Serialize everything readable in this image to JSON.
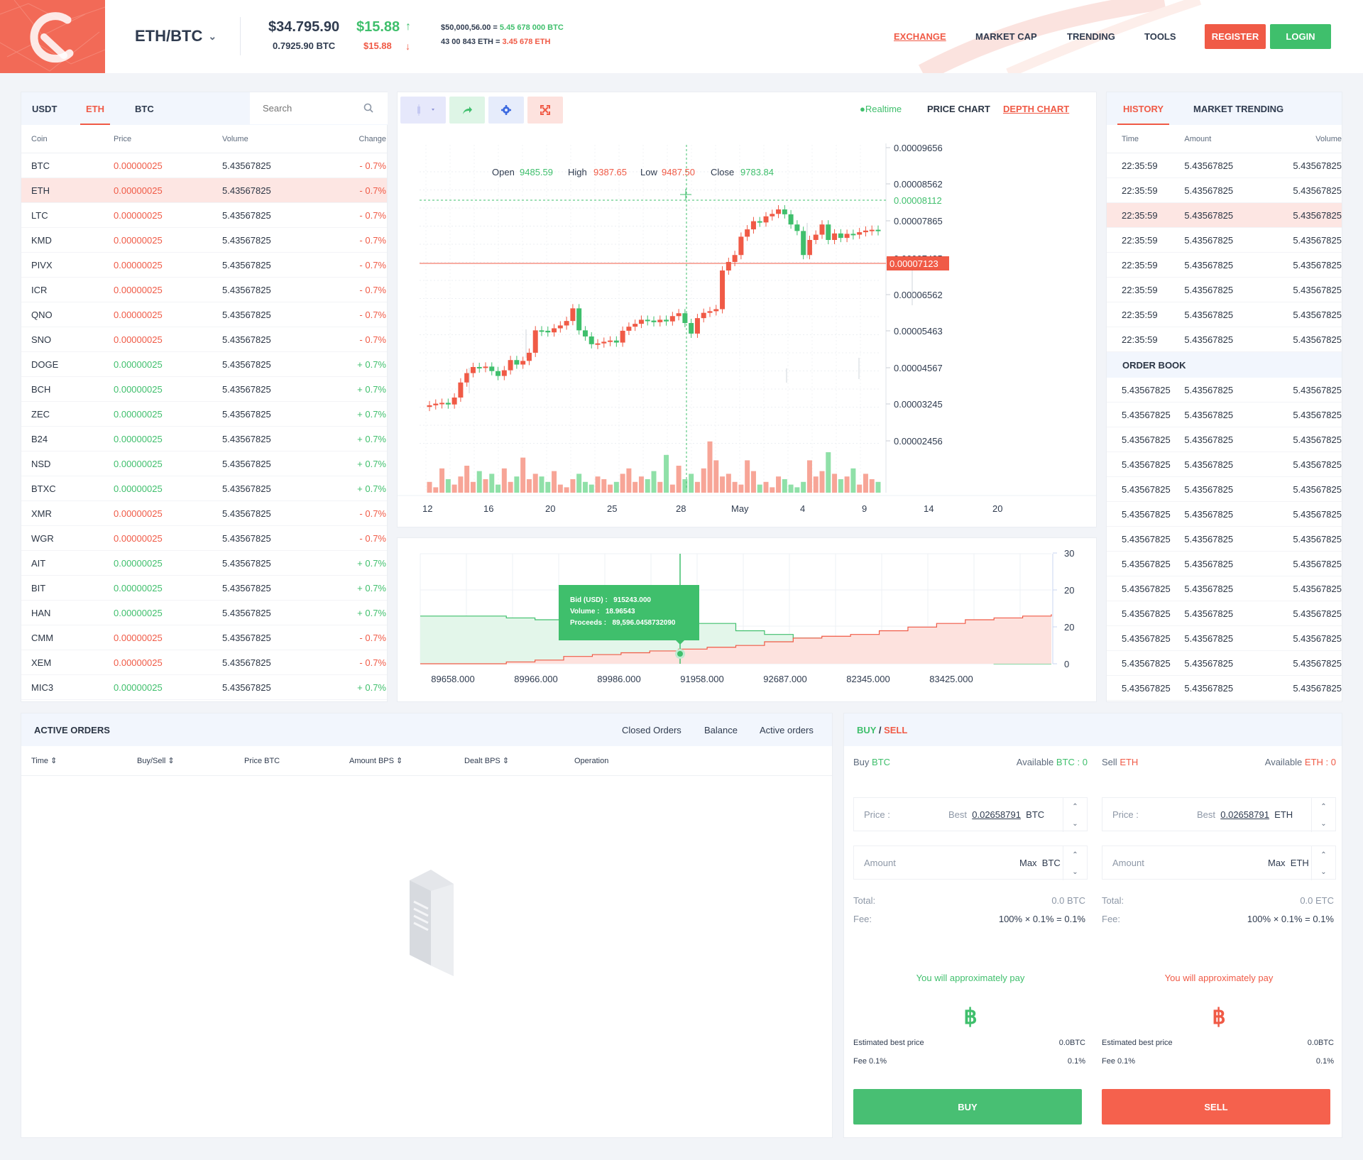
{
  "header": {
    "pair": "ETH/BTC",
    "price_usd": "$34.795.90",
    "price_btc": "0.7925.90 BTC",
    "change_up": "$15.88",
    "change_down": "$15.88",
    "conv1_a": "$50,000,56.00 = ",
    "conv1_b": "5.45 678 000 BTC",
    "conv2_a": "43 00 843 ETH = ",
    "conv2_b": "3.45 678 ETH",
    "nav": [
      "EXCHANGE",
      "MARKET CAP",
      "TRENDING",
      "TOOLS"
    ],
    "register": "REGISTER",
    "login": "LOGIN"
  },
  "market": {
    "tabs": [
      "USDT",
      "ETH",
      "BTC"
    ],
    "active_tab": "ETH",
    "search_placeholder": "Search",
    "columns": [
      "Coin",
      "Price",
      "Volume",
      "Change"
    ],
    "rows": [
      {
        "coin": "BTC",
        "price": "0.00000025",
        "volume": "5.43567825",
        "change": "- 0.7%",
        "dir": "down"
      },
      {
        "coin": "ETH",
        "price": "0.00000025",
        "volume": "5.43567825",
        "change": "- 0.7%",
        "dir": "down"
      },
      {
        "coin": "LTC",
        "price": "0.00000025",
        "volume": "5.43567825",
        "change": "- 0.7%",
        "dir": "down"
      },
      {
        "coin": "KMD",
        "price": "0.00000025",
        "volume": "5.43567825",
        "change": "- 0.7%",
        "dir": "down"
      },
      {
        "coin": "PIVX",
        "price": "0.00000025",
        "volume": "5.43567825",
        "change": "- 0.7%",
        "dir": "down"
      },
      {
        "coin": "ICR",
        "price": "0.00000025",
        "volume": "5.43567825",
        "change": "- 0.7%",
        "dir": "down"
      },
      {
        "coin": "QNO",
        "price": "0.00000025",
        "volume": "5.43567825",
        "change": "- 0.7%",
        "dir": "down"
      },
      {
        "coin": "SNO",
        "price": "0.00000025",
        "volume": "5.43567825",
        "change": "- 0.7%",
        "dir": "down"
      },
      {
        "coin": "DOGE",
        "price": "0.00000025",
        "volume": "5.43567825",
        "change": "+ 0.7%",
        "dir": "up"
      },
      {
        "coin": "BCH",
        "price": "0.00000025",
        "volume": "5.43567825",
        "change": "+ 0.7%",
        "dir": "up"
      },
      {
        "coin": "ZEC",
        "price": "0.00000025",
        "volume": "5.43567825",
        "change": "+ 0.7%",
        "dir": "up"
      },
      {
        "coin": "B24",
        "price": "0.00000025",
        "volume": "5.43567825",
        "change": "+ 0.7%",
        "dir": "up"
      },
      {
        "coin": "NSD",
        "price": "0.00000025",
        "volume": "5.43567825",
        "change": "+ 0.7%",
        "dir": "up"
      },
      {
        "coin": "BTXC",
        "price": "0.00000025",
        "volume": "5.43567825",
        "change": "+ 0.7%",
        "dir": "up"
      },
      {
        "coin": "XMR",
        "price": "0.00000025",
        "volume": "5.43567825",
        "change": "- 0.7%",
        "dir": "down"
      },
      {
        "coin": "WGR",
        "price": "0.00000025",
        "volume": "5.43567825",
        "change": "- 0.7%",
        "dir": "down"
      },
      {
        "coin": "AIT",
        "price": "0.00000025",
        "volume": "5.43567825",
        "change": "+ 0.7%",
        "dir": "up"
      },
      {
        "coin": "BIT",
        "price": "0.00000025",
        "volume": "5.43567825",
        "change": "+ 0.7%",
        "dir": "up"
      },
      {
        "coin": "HAN",
        "price": "0.00000025",
        "volume": "5.43567825",
        "change": "+ 0.7%",
        "dir": "up"
      },
      {
        "coin": "CMM",
        "price": "0.00000025",
        "volume": "5.43567825",
        "change": "- 0.7%",
        "dir": "down"
      },
      {
        "coin": "XEM",
        "price": "0.00000025",
        "volume": "5.43567825",
        "change": "- 0.7%",
        "dir": "down"
      },
      {
        "coin": "MIC3",
        "price": "0.00000025",
        "volume": "5.43567825",
        "change": "+ 0.7%",
        "dir": "up"
      }
    ]
  },
  "chart": {
    "realtime": "Realtime",
    "price_chart": "PRICE CHART",
    "depth_chart": "DEPTH CHART",
    "ohlc": {
      "open_label": "Open",
      "open": "9485.59",
      "high_label": "High",
      "high": "9387.65",
      "low_label": "Low",
      "low": "9487.50",
      "close_label": "Close",
      "close": "9783.84"
    },
    "y_ticks": [
      "0.00009656",
      "0.00008562",
      "0.00007865",
      "0.00007435",
      "0.00006562",
      "0.00005463",
      "0.00004567",
      "0.00003245",
      "0.00002456"
    ],
    "crosshair_value": "0.00008112",
    "current_price": "0.00007123",
    "x_ticks": [
      "12",
      "16",
      "20",
      "25",
      "28",
      "May",
      "4",
      "9",
      "14",
      "20"
    ],
    "colors": {
      "up": "#3fbf6c",
      "down": "#f05a46"
    }
  },
  "chart_data": [
    {
      "type": "candlestick",
      "y_ticks": [
        9.656e-05,
        8.562e-05,
        7.865e-05,
        7.435e-05,
        6.562e-05,
        5.463e-05,
        4.567e-05,
        3.245e-05,
        2.456e-05
      ],
      "ylim": [
        2.456e-05,
        9.656e-05
      ],
      "x_ticks": [
        "12",
        "16",
        "20",
        "25",
        "28",
        "May",
        "4",
        "9",
        "14",
        "20"
      ],
      "close": [
        3.26e-05,
        3.3e-05,
        3.32e-05,
        3.28e-05,
        3.45e-05,
        3.82e-05,
        4.05e-05,
        4.2e-05,
        4.18e-05,
        4.21e-05,
        4.1e-05,
        3.98e-05,
        4.12e-05,
        4.37e-05,
        4.26e-05,
        4.35e-05,
        4.55e-05,
        5.1e-05,
        5.09e-05,
        5.05e-05,
        5.15e-05,
        5.22e-05,
        5.33e-05,
        5.64e-05,
        5.1e-05,
        4.95e-05,
        4.76e-05,
        4.78e-05,
        4.82e-05,
        4.85e-05,
        4.8e-05,
        5.09e-05,
        5.19e-05,
        5.26e-05,
        5.36e-05,
        5.34e-05,
        5.3e-05,
        5.36e-05,
        5.32e-05,
        5.45e-05,
        5.52e-05,
        5.28e-05,
        5.02e-05,
        5.4e-05,
        5.53e-05,
        5.57e-05,
        5.62e-05,
        6.57e-05,
        6.78e-05,
        6.95e-05,
        7.4e-05,
        7.58e-05,
        7.78e-05,
        7.75e-05,
        7.9e-05,
        7.96e-05,
        8.07e-05,
        7.95e-05,
        7.7e-05,
        7.54e-05,
        6.95e-05,
        7.32e-05,
        7.45e-05,
        7.7e-05,
        7.32e-05,
        7.48e-05,
        7.37e-05,
        7.47e-05,
        7.45e-05,
        7.51e-05,
        7.55e-05,
        7.57e-05,
        7.54e-05
      ],
      "volume": [
        0.4,
        0.2,
        0.9,
        0.5,
        0.3,
        0.6,
        1.0,
        0.4,
        0.8,
        0.5,
        0.7,
        0.3,
        0.9,
        0.4,
        0.6,
        1.3,
        0.5,
        0.7,
        0.6,
        0.4,
        0.8,
        0.3,
        0.2,
        0.5,
        0.7,
        0.4,
        0.3,
        0.6,
        0.5,
        0.3,
        0.4,
        0.7,
        0.9,
        0.4,
        0.6,
        0.5,
        0.8,
        0.4,
        1.4,
        0.3,
        1.0,
        0.5,
        0.7,
        0.4,
        0.9,
        1.9,
        1.2,
        0.6,
        0.7,
        0.4,
        0.3,
        1.2,
        0.8,
        0.3,
        0.4,
        0.2,
        0.6,
        0.5,
        0.3,
        0.2,
        0.4,
        1.2,
        0.6,
        0.8,
        1.5,
        0.7,
        0.5,
        0.6,
        0.9,
        0.3,
        0.7,
        0.5,
        0.4
      ]
    },
    {
      "type": "area",
      "x_ticks": [
        "89658.000",
        "89966.000",
        "89986.000",
        "91958.000",
        "92687.000",
        "82345.000",
        "83425.000"
      ],
      "y_ticks": [
        "30",
        "20",
        "20",
        "0"
      ],
      "bids": [
        13,
        13,
        13,
        12.5,
        12,
        11.5,
        11.5,
        11.5,
        11.5,
        11,
        11,
        9,
        8,
        7,
        6.5,
        4.5,
        4,
        3.5,
        3,
        2.5,
        0,
        0,
        0
      ],
      "asks": [
        0,
        0,
        0,
        0.5,
        1,
        2,
        2.5,
        3,
        3.5,
        4,
        4.5,
        5,
        6,
        7,
        7.5,
        8,
        9,
        10,
        11,
        12,
        12.5,
        13,
        13.5
      ]
    }
  ],
  "depth": {
    "tooltip": {
      "bid_label": "Bid (USD) :",
      "bid": "915243.000",
      "volume_label": "Volume :",
      "volume": "18.96543",
      "proceeds_label": "Proceeds :",
      "proceeds": "89,596.0458732090"
    }
  },
  "history": {
    "tabs": [
      "HISTORY",
      "MARKET TRENDING"
    ],
    "columns": [
      "Time",
      "Amount",
      "Volume"
    ],
    "rows": [
      {
        "time": "22:35:59",
        "amount": "5.43567825",
        "volume": "5.43567825"
      },
      {
        "time": "22:35:59",
        "amount": "5.43567825",
        "volume": "5.43567825"
      },
      {
        "time": "22:35:59",
        "amount": "5.43567825",
        "volume": "5.43567825"
      },
      {
        "time": "22:35:59",
        "amount": "5.43567825",
        "volume": "5.43567825"
      },
      {
        "time": "22:35:59",
        "amount": "5.43567825",
        "volume": "5.43567825"
      },
      {
        "time": "22:35:59",
        "amount": "5.43567825",
        "volume": "5.43567825"
      },
      {
        "time": "22:35:59",
        "amount": "5.43567825",
        "volume": "5.43567825"
      },
      {
        "time": "22:35:59",
        "amount": "5.43567825",
        "volume": "5.43567825"
      }
    ],
    "orderbook_title": "ORDER BOOK",
    "orderbook": [
      [
        "5.43567825",
        "5.43567825",
        "5.43567825"
      ],
      [
        "5.43567825",
        "5.43567825",
        "5.43567825"
      ],
      [
        "5.43567825",
        "5.43567825",
        "5.43567825"
      ],
      [
        "5.43567825",
        "5.43567825",
        "5.43567825"
      ],
      [
        "5.43567825",
        "5.43567825",
        "5.43567825"
      ],
      [
        "5.43567825",
        "5.43567825",
        "5.43567825"
      ],
      [
        "5.43567825",
        "5.43567825",
        "5.43567825"
      ],
      [
        "5.43567825",
        "5.43567825",
        "5.43567825"
      ],
      [
        "5.43567825",
        "5.43567825",
        "5.43567825"
      ],
      [
        "5.43567825",
        "5.43567825",
        "5.43567825"
      ],
      [
        "5.43567825",
        "5.43567825",
        "5.43567825"
      ],
      [
        "5.43567825",
        "5.43567825",
        "5.43567825"
      ],
      [
        "5.43567825",
        "5.43567825",
        "5.43567825"
      ]
    ]
  },
  "orders": {
    "title": "ACTIVE ORDERS",
    "tabs": [
      "Closed Orders",
      "Balance",
      "Active orders"
    ],
    "columns": [
      "Time",
      "Buy/Sell",
      "Price BTC",
      "Amount BPS",
      "Dealt BPS",
      "Operation"
    ]
  },
  "trade": {
    "title_buy": "BUY",
    "title_sep": " / ",
    "title_sell": "SELL",
    "buy": {
      "label": "Buy",
      "coin": "BTC",
      "avail_label": "Available",
      "avail_value": "BTC : 0",
      "price_label": "Price :",
      "best_label": "Best",
      "best_value": "0.02658791",
      "unit": "BTC",
      "amount_label": "Amount",
      "max_label": "Max",
      "total_label": "Total:",
      "total_value": "0.0 BTC",
      "fee_label": "Fee:",
      "fee_value": "100% × 0.1% = 0.1%",
      "approx": "You will approximately pay",
      "symbol": "฿",
      "est_label": "Estimated best price",
      "est_value": "0.0BTC",
      "fee_pct_label": "Fee 0.1%",
      "fee_pct_value": "0.1%",
      "button": "BUY"
    },
    "sell": {
      "label": "Sell",
      "coin": "ETH",
      "avail_label": "Available",
      "avail_value": "ETH : 0",
      "price_label": "Price :",
      "best_label": "Best",
      "best_value": "0.02658791",
      "unit": "ETH",
      "amount_label": "Amount",
      "max_label": "Max",
      "total_label": "Total:",
      "total_value": "0.0 ETC",
      "fee_label": "Fee:",
      "fee_value": "100% × 0.1% = 0.1%",
      "approx": "You will approximately pay",
      "symbol": "฿",
      "est_label": "Estimated best price",
      "est_value": "0.0BTC",
      "fee_pct_label": "Fee 0.1%",
      "fee_pct_value": "0.1%",
      "button": "SELL"
    }
  }
}
